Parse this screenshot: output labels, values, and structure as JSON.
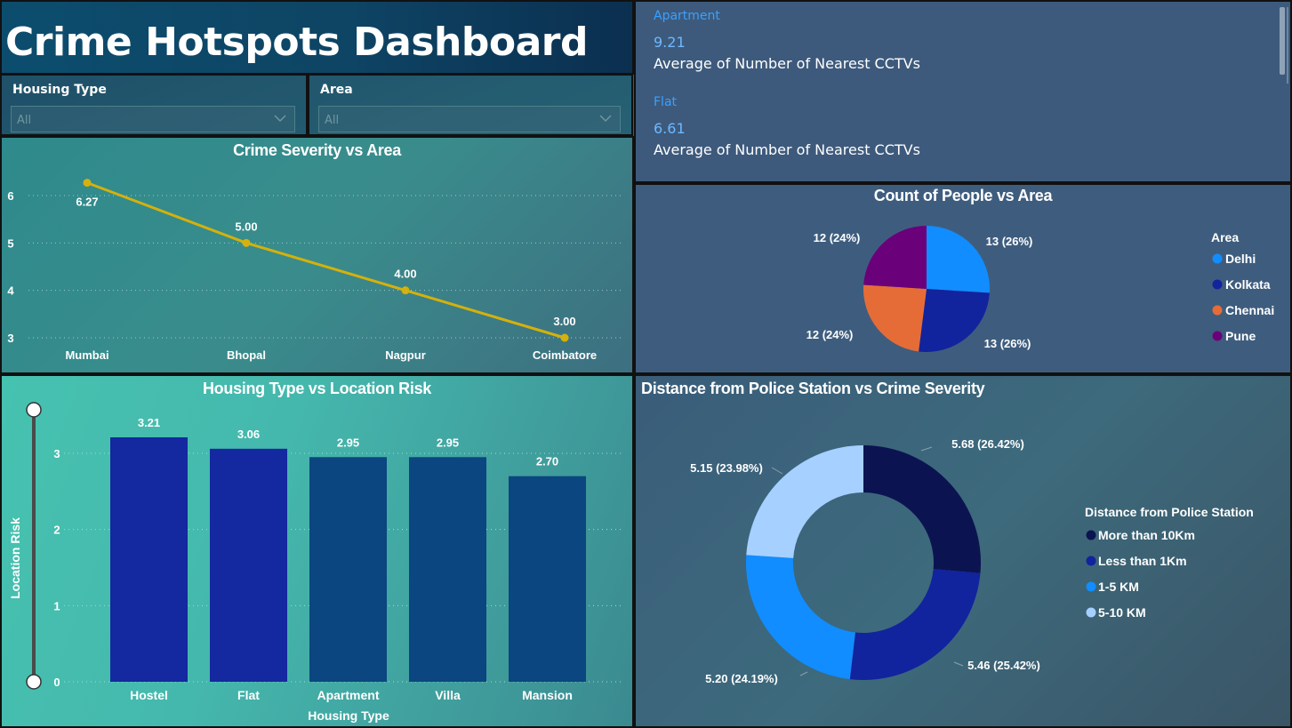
{
  "page": {
    "title": "Crime Hotspots Dashboard"
  },
  "slicers": [
    {
      "label": "Housing Type",
      "value": "All",
      "icon": "chevron-down-icon"
    },
    {
      "label": "Area",
      "value": "All",
      "icon": "chevron-down-icon"
    }
  ],
  "kpis": [
    {
      "category": "Apartment",
      "value": "9.21",
      "label": "Average of Number of Nearest CCTVs"
    },
    {
      "category": "Flat",
      "value": "6.61",
      "label": "Average of Number of Nearest CCTVs"
    }
  ],
  "colors": {
    "line": "#d4b10c",
    "bar_dark": "#1428a0",
    "bar_mid": "#0b4680",
    "delhi": "#118dff",
    "kolkata": "#12239e",
    "chennai": "#e66c37",
    "pune": "#6b007b",
    "more_than_10km": "#0b1450",
    "less_than_1km": "#12239e",
    "one_to_five_km": "#118dff",
    "five_to_ten_km": "#a6d0ff"
  },
  "chart_data": [
    {
      "type": "line",
      "title": "Crime Severity vs Area",
      "categories": [
        "Mumbai",
        "Bhopal",
        "Nagpur",
        "Coimbatore"
      ],
      "values": [
        6.27,
        5.0,
        4.0,
        3.0
      ],
      "data_labels": [
        "6.27",
        "5.00",
        "4.00",
        "3.00"
      ],
      "y_ticks": [
        "3",
        "4",
        "5",
        "6"
      ],
      "ylim": [
        3,
        6
      ],
      "grid": true
    },
    {
      "type": "pie",
      "title": "Count of People vs Area",
      "legend_title": "Area",
      "legend_position": "right",
      "categories": [
        "Delhi",
        "Kolkata",
        "Chennai",
        "Pune"
      ],
      "values": [
        13,
        13,
        12,
        12
      ],
      "data_labels": [
        "13 (26%)",
        "13 (26%)",
        "12 (24%)",
        "12 (24%)"
      ]
    },
    {
      "type": "bar",
      "title": "Housing Type vs Location Risk",
      "xlabel": "Housing Type",
      "ylabel": "Location Risk",
      "categories": [
        "Hostel",
        "Flat",
        "Apartment",
        "Villa",
        "Mansion"
      ],
      "values": [
        3.21,
        3.06,
        2.95,
        2.95,
        2.7
      ],
      "data_labels": [
        "3.21",
        "3.06",
        "2.95",
        "2.95",
        "2.70"
      ],
      "y_ticks": [
        "0",
        "1",
        "2",
        "3"
      ],
      "ylim": [
        0,
        3.21
      ],
      "grid": true
    },
    {
      "type": "pie",
      "title": "Distance from Police Station vs Crime Severity",
      "legend_title": "Distance from Police Station",
      "legend_position": "right",
      "categories": [
        "More than 10Km",
        "Less than 1Km",
        "1-5 KM",
        "5-10 KM"
      ],
      "values": [
        5.68,
        5.46,
        5.2,
        5.15
      ],
      "data_labels": [
        "5.68 (26.42%)",
        "5.46 (25.42%)",
        "5.20 (24.19%)",
        "5.15 (23.98%)"
      ]
    }
  ]
}
